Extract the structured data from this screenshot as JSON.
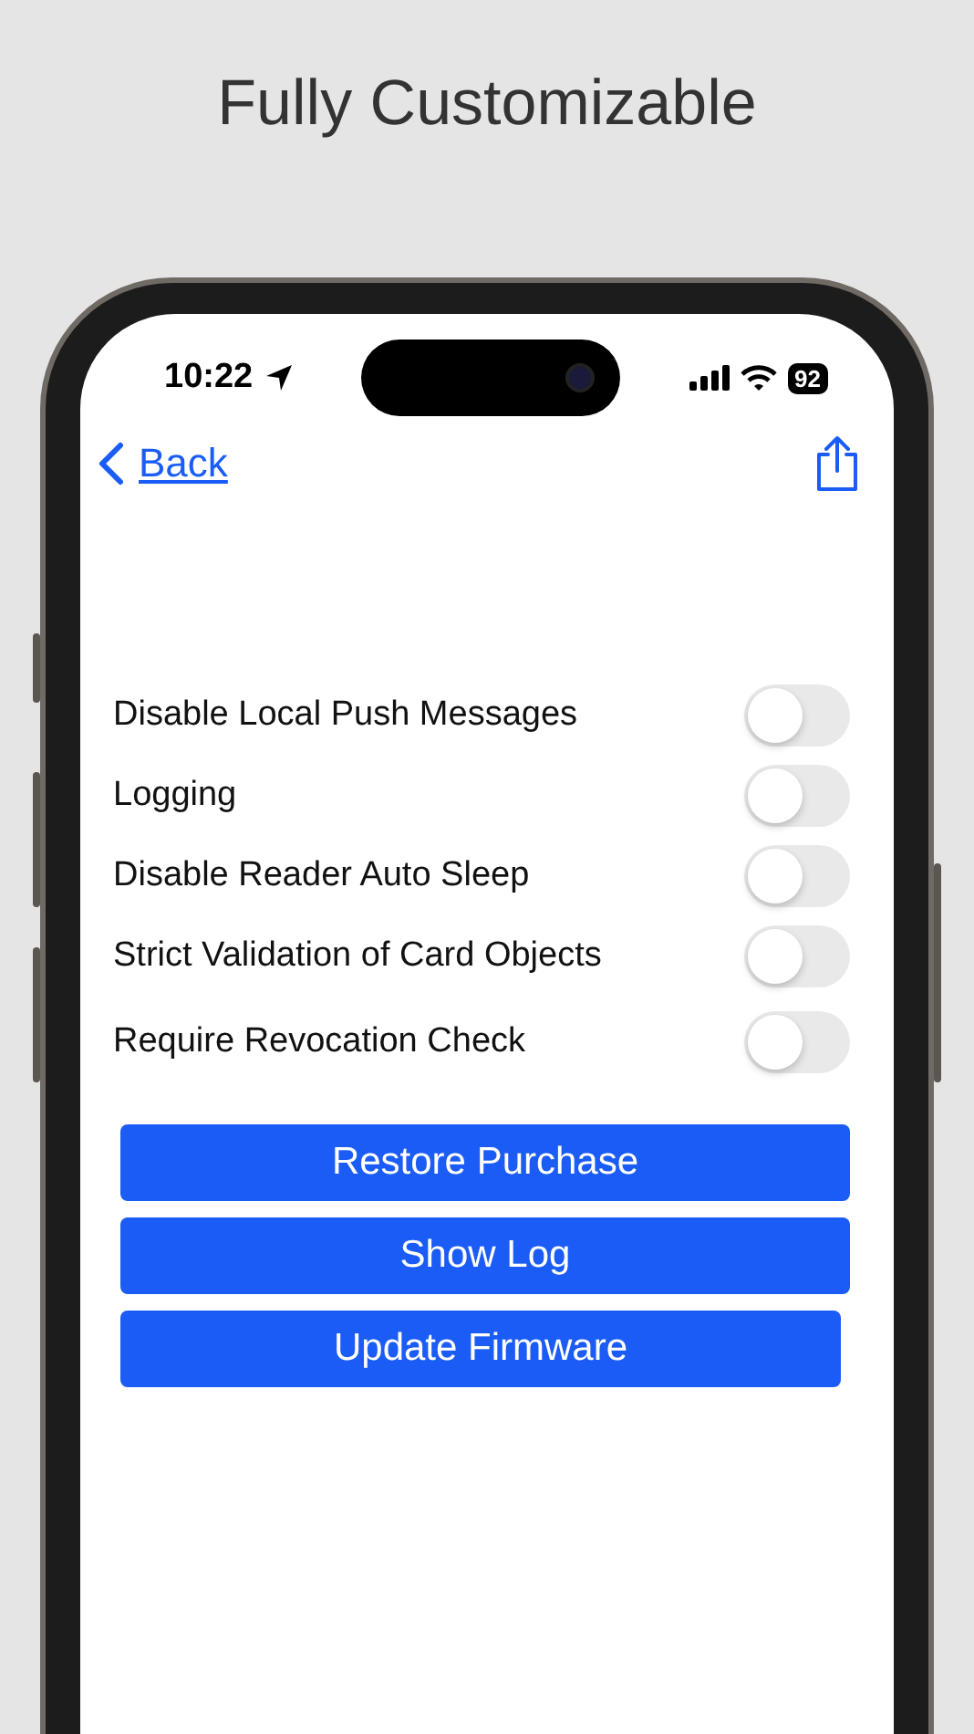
{
  "header": {
    "title": "Fully Customizable"
  },
  "status_bar": {
    "time": "10:22",
    "battery": "92"
  },
  "nav": {
    "back": "Back"
  },
  "settings": [
    {
      "label": "Disable Local Push Messages",
      "on": false
    },
    {
      "label": "Logging",
      "on": false
    },
    {
      "label": "Disable Reader Auto Sleep",
      "on": false
    },
    {
      "label": "Strict Validation of Card Objects",
      "on": false
    },
    {
      "label": "Require Revocation Check",
      "on": false
    }
  ],
  "buttons": [
    "Restore Purchase",
    "Show Log",
    "Update Firmware"
  ]
}
